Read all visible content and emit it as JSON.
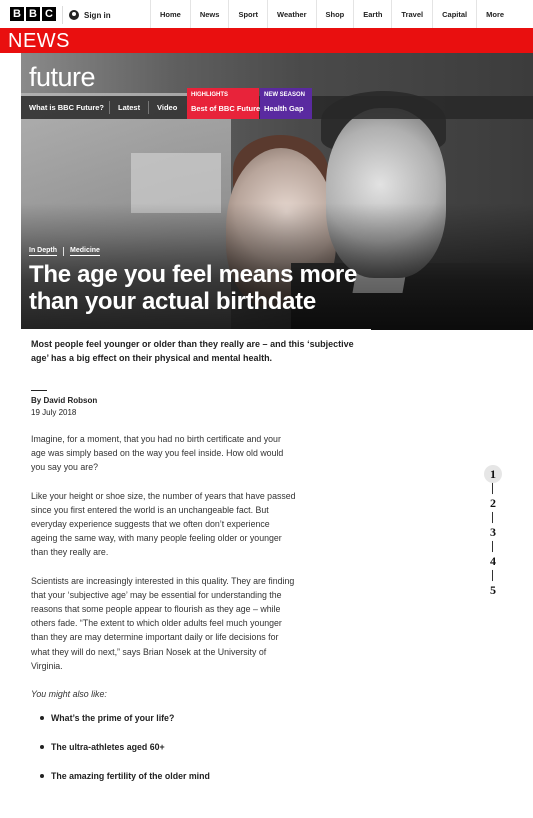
{
  "topbar": {
    "logo_letters": [
      "B",
      "B",
      "C"
    ],
    "signin_label": "Sign in",
    "nav": [
      "Home",
      "News",
      "Sport",
      "Weather",
      "Shop",
      "Earth",
      "Travel",
      "Capital",
      "More"
    ]
  },
  "newsbar": {
    "label": "NEWS"
  },
  "future": {
    "logo": "future",
    "nav": {
      "what": "What is BBC Future?",
      "latest": "Latest",
      "video": "Video"
    },
    "promo_highlights": {
      "kicker": "HIGHLIGHTS",
      "title": "Best of BBC Future"
    },
    "promo_new_season": {
      "kicker": "NEW SEASON",
      "title": "Health Gap"
    }
  },
  "article": {
    "tags": [
      "In Depth",
      "Medicine"
    ],
    "headline": "The age you feel means more than your actual birthdate",
    "summary": "Most people feel younger or older than they really are – and this ‘subjective age’ has a big effect on their physical and mental health.",
    "byline": "By David Robson",
    "date": "19 July 2018",
    "paragraphs": [
      "Imagine, for a moment, that you had no birth certificate and your age was simply based on the way you feel inside. How old would you say you are?",
      "Like your height or shoe size, the number of years that have passed since you first entered the world is an unchangeable fact. But everyday experience suggests that we often don’t experience ageing the same way, with many people feeling older or younger than they really are.",
      "Scientists are increasingly interested in this quality. They are finding that your ‘subjective age’ may be essential for understanding the reasons that some people appear to flourish as they age – while others fade. “The extent to which older adults feel much younger than they are may determine important daily or life decisions for what they will do next,” says Brian Nosek at the University of Virginia."
    ],
    "also_like_label": "You might also like:",
    "related": [
      "What’s the prime of your life?",
      "The ultra-athletes aged 60+",
      "The amazing fertility of the older mind"
    ]
  },
  "stepper": {
    "steps": [
      "1",
      "2",
      "3",
      "4",
      "5"
    ],
    "active_index": 0
  }
}
